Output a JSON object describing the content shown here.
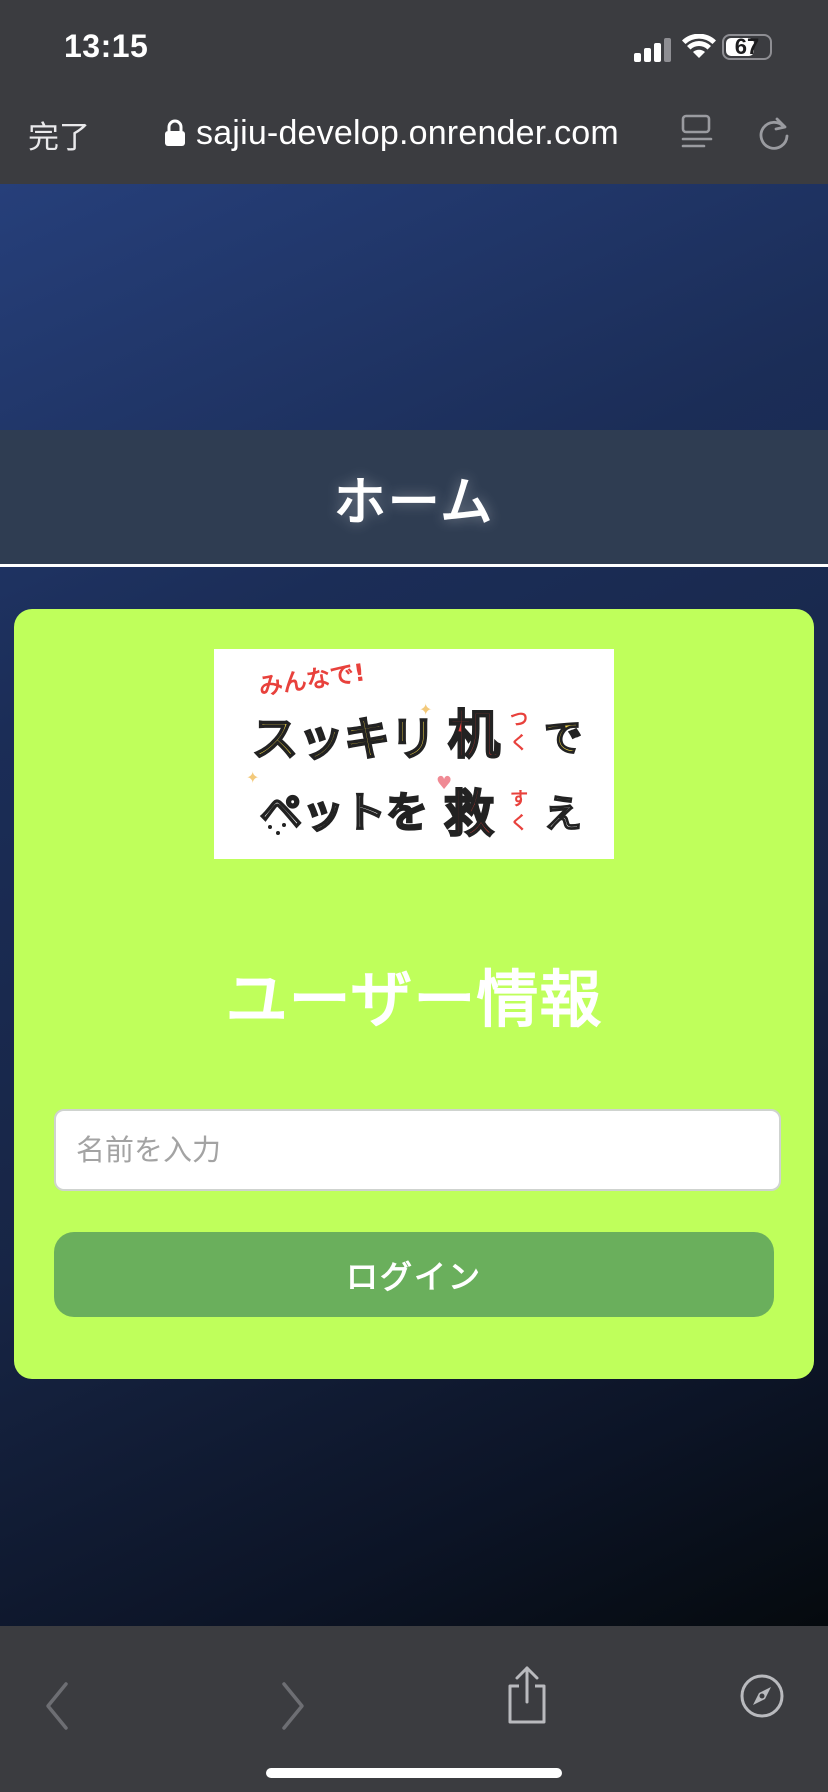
{
  "status_bar": {
    "time": "13:15",
    "battery_text": "67",
    "battery_level": 0.67
  },
  "browser": {
    "done_label": "完了",
    "url": "sajiu-develop.onrender.com"
  },
  "page": {
    "header_title": "ホーム",
    "card": {
      "logo_line1": "みんなで!",
      "logo_line2_main": "スッキリ",
      "logo_line2_kanji": "机",
      "logo_line2_ruby": "つくえ",
      "logo_line2_tail": "で",
      "logo_line3_main": "ペットを",
      "logo_line3_kanji": "救",
      "logo_line3_ruby": "すく",
      "logo_line3_tail": "え",
      "title": "ユーザー情報",
      "name_placeholder": "名前を入力",
      "name_value": "",
      "login_label": "ログイン"
    }
  },
  "colors": {
    "chrome": "#3b3c40",
    "header_band": "#2f3d52",
    "card": "#bfff5b",
    "login_button": "#6aaf5c"
  },
  "icons": {
    "secure": "lock-icon",
    "reader": "reader-mode-icon",
    "reload": "reload-icon",
    "back": "chevron-left-icon",
    "forward": "chevron-right-icon",
    "share": "share-icon",
    "browser": "compass-icon"
  }
}
